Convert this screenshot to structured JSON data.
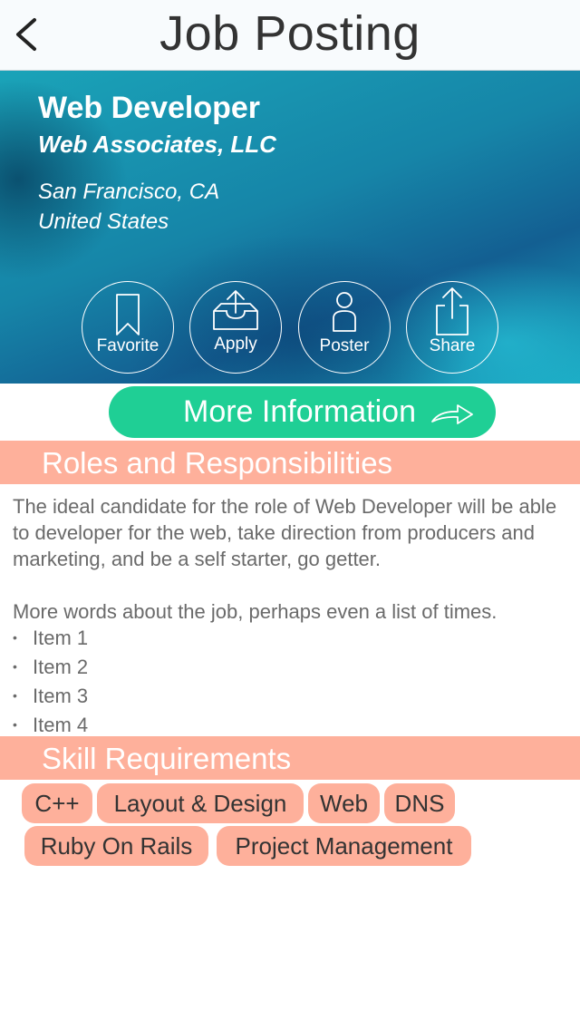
{
  "nav": {
    "title": "Job Posting"
  },
  "job": {
    "title": "Web Developer",
    "company": "Web Associates, LLC",
    "city": "San Francisco, CA",
    "country": "United States"
  },
  "actions": {
    "favorite": "Favorite",
    "apply": "Apply",
    "poster": "Poster",
    "share": "Share"
  },
  "more_info": {
    "label": "More Information"
  },
  "roles": {
    "heading": "Roles and Responsibilities",
    "description": "The ideal candidate for the role of Web Developer will be able to developer for the web, take direction from producers and marketing, and be a self starter, go getter.",
    "more": "More words about the job, perhaps even a list of times.",
    "items": [
      "Item 1",
      "Item 2",
      "Item 3",
      "Item 4"
    ]
  },
  "skills": {
    "heading": "Skill Requirements",
    "tags": [
      "C++",
      "Layout & Design",
      "Web",
      "DNS",
      "Ruby On Rails",
      "Project Management"
    ]
  },
  "colors": {
    "accent_green": "#1fcf95",
    "section_salmon": "#feb09b",
    "hero_teal": "#1685a8"
  }
}
